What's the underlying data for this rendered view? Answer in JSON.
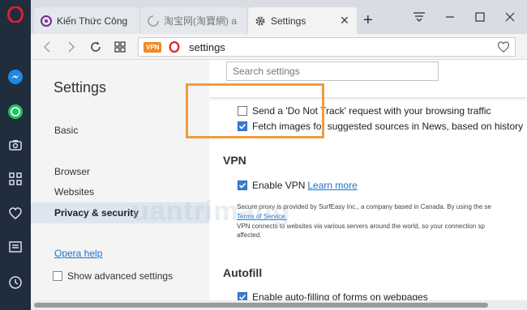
{
  "tabs": [
    {
      "title": "Kiến Thức Công",
      "icon": "quantrimang-favicon",
      "active": false
    },
    {
      "title": "淘宝网(淘寶網) a",
      "icon": "loading-spinner-icon",
      "active": false
    },
    {
      "title": "Settings",
      "icon": "gear-icon",
      "active": true
    }
  ],
  "address_bar": {
    "vpn_badge": "VPN",
    "url": "settings"
  },
  "sidebar_icons": [
    "opera-logo",
    "messenger-icon",
    "whatsapp-icon",
    "camera-icon",
    "apps-grid-icon",
    "heart-icon",
    "news-icon",
    "history-clock-icon"
  ],
  "settings": {
    "title": "Settings",
    "nav": {
      "basic": "Basic",
      "browser": "Browser",
      "websites": "Websites",
      "privacy": "Privacy & security"
    },
    "help": "Opera help",
    "advanced": "Show advanced settings"
  },
  "search": {
    "placeholder": "Search settings"
  },
  "privacy": {
    "dnt": "Send a 'Do Not Track' request with your browsing traffic",
    "fetch_images": "Fetch images for suggested sources in News, based on history"
  },
  "vpn": {
    "title": "VPN",
    "enable": "Enable VPN",
    "learn_more": "Learn more",
    "desc1": "Secure proxy is provided by SurfEasy Inc., a company based in Canada. By using the se",
    "terms": "Terms of Service.",
    "desc2": "VPN connects to websites via various servers around the world, so your connection sp",
    "desc3": "affected."
  },
  "autofill": {
    "title": "Autofill",
    "enable": "Enable auto-filling of forms on webpages"
  },
  "watermark": "uantrimang",
  "colors": {
    "accent": "#3b7bd4",
    "highlight_box": "#f39a3c",
    "opera_red": "#e0202a",
    "sidebar_bg": "#1f2d3d"
  }
}
